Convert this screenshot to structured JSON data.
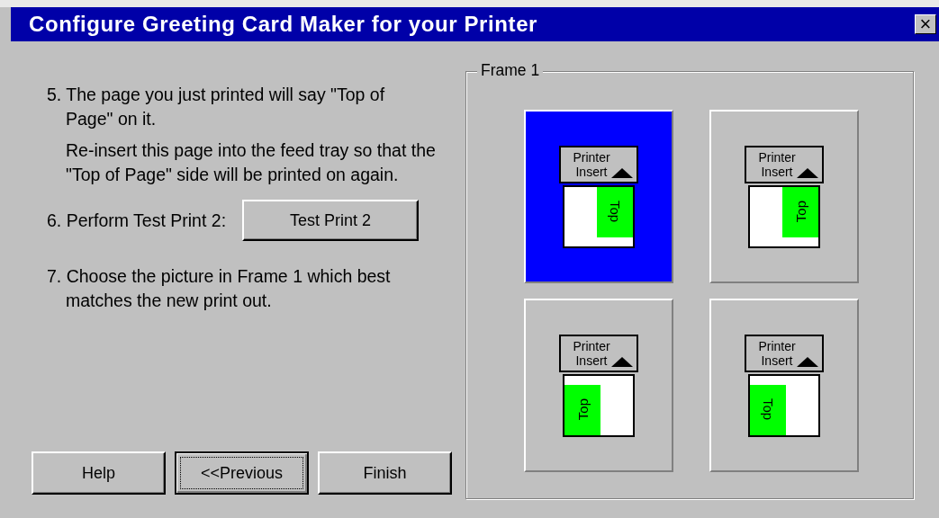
{
  "window": {
    "title": "Configure Greeting Card Maker for your Printer",
    "close": "×"
  },
  "steps": [
    {
      "kind": "text",
      "text": "5. The page you just printed will say \"Top of Page\" on it."
    },
    {
      "kind": "note",
      "text": "Re-insert this page into the feed tray so that the \"Top of Page\" side will be printed on again."
    },
    {
      "kind": "action",
      "text": "6. Perform Test Print 2:",
      "button": "Test Print 2"
    },
    {
      "kind": "text",
      "text": "7. Choose the picture in Frame 1 which best matches the new print out."
    }
  ],
  "buttons": [
    {
      "label": "Help",
      "focused": false
    },
    {
      "label": "<<Previous",
      "focused": true
    },
    {
      "label": "Finish",
      "focused": false
    }
  ],
  "frame": {
    "title": "Frame 1",
    "options": [
      {
        "selected": true,
        "header": "Printer Insert",
        "mark": "Top",
        "kind": "rightdown"
      },
      {
        "selected": false,
        "header": "Printer Insert",
        "mark": "Top",
        "kind": "rightup"
      },
      {
        "selected": false,
        "header": "Printer Insert",
        "mark": "Top",
        "kind": "leftup"
      },
      {
        "selected": false,
        "header": "Printer Insert",
        "mark": "Top",
        "kind": "leftdown"
      }
    ]
  }
}
